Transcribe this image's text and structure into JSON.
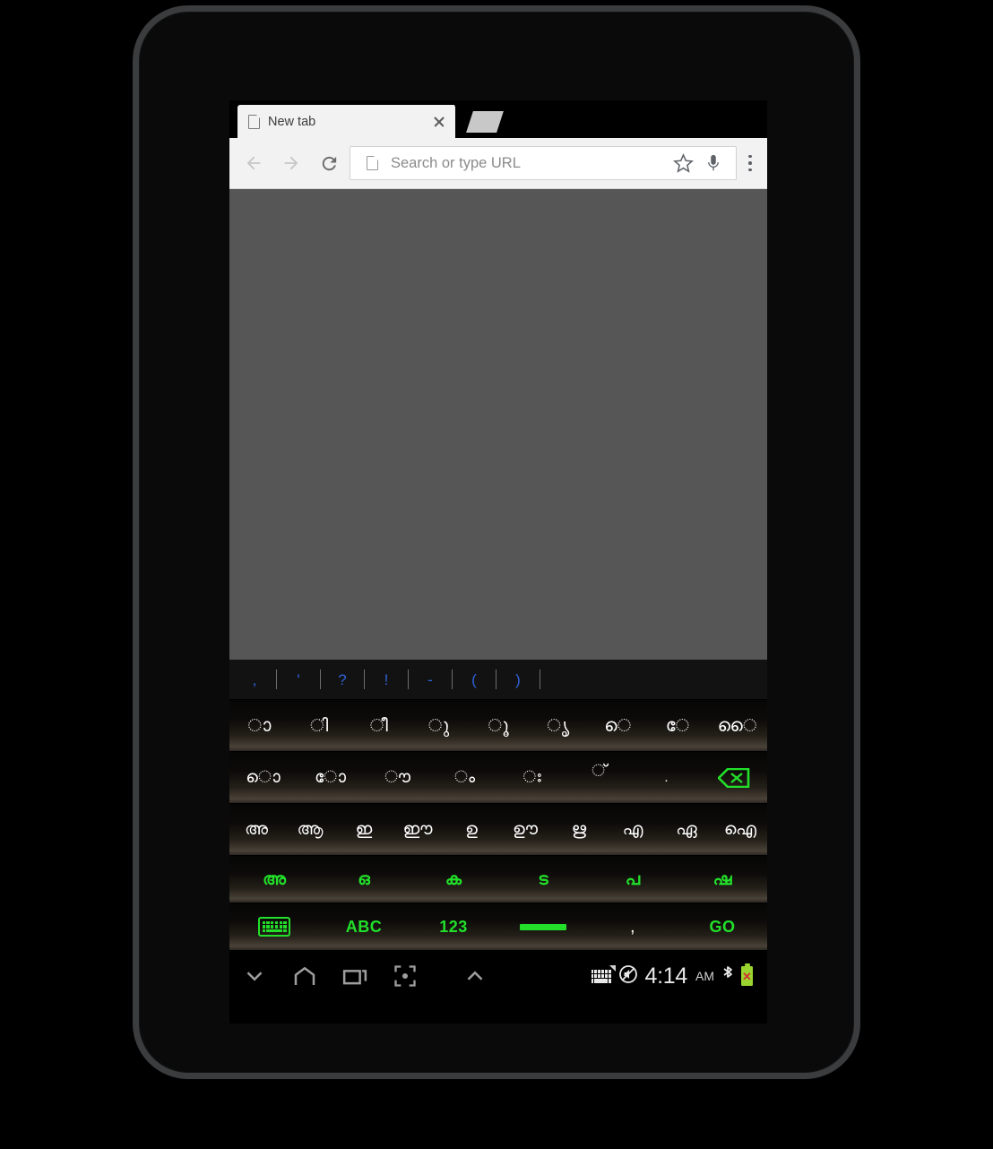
{
  "browser": {
    "tab": {
      "title": "New tab",
      "page_icon": "page-icon",
      "close_icon": "close-icon"
    },
    "toolbar": {
      "back_icon": "back-arrow-icon",
      "forward_icon": "forward-arrow-icon",
      "reload_icon": "reload-icon",
      "omnibox_placeholder": "Search or type URL",
      "omnibox_value": "",
      "bookmark_icon": "star-icon",
      "voice_icon": "microphone-icon",
      "menu_icon": "overflow-menu-icon"
    }
  },
  "keyboard": {
    "suggestions": [
      ",",
      "'",
      "?",
      "!",
      "-",
      "(",
      ")"
    ],
    "suggestion_color": "#2f63d8",
    "rows": [
      {
        "name": "vowel-signs",
        "keys": [
          "ാ",
          "ി",
          "ീ",
          "ു",
          "ൂ",
          "ൃ",
          "െ",
          "േ",
          "ൈ"
        ]
      },
      {
        "name": "vowel-signs-2",
        "keys": [
          "ൊ",
          "ോ",
          "ൗ",
          "ം",
          "ഃ",
          "്",
          ".",
          "backspace-icon"
        ]
      },
      {
        "name": "independent-vowels",
        "keys": [
          "അ",
          "ആ",
          "ഇ",
          "ഈ",
          "ഉ",
          "ഊ",
          "ഋ",
          "എ",
          "ഏ",
          "ഐ"
        ]
      },
      {
        "name": "consonant-groups",
        "keys": [
          "അ",
          "ഒ",
          "ക",
          "ട",
          "പ",
          "ഷ"
        ]
      }
    ],
    "function_row": {
      "keyboard_switch": "keyboard-icon",
      "abc_label": "ABC",
      "numeric_label": "123",
      "space_label": "",
      "comma_label": ",",
      "go_label": "GO"
    },
    "green": "#22e02a"
  },
  "navbar": {
    "hide_keyboard_icon": "chevron-down-icon",
    "home_icon": "home-icon",
    "recents_icon": "recent-apps-icon",
    "screenshot_icon": "screenshot-icon",
    "expand_icon": "chevron-up-icon",
    "status": {
      "keyboard_indicator_icon": "keyboard-status-icon",
      "mute_icon": "no-sound-icon",
      "time": "4:14",
      "meridiem": "AM",
      "bluetooth_icon": "bluetooth-icon",
      "battery_icon": "battery-error-icon"
    }
  }
}
